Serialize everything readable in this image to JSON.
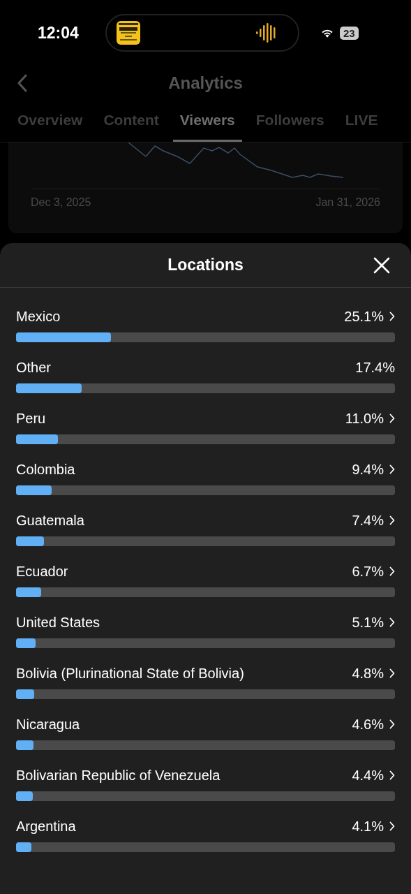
{
  "status_bar": {
    "time": "12:04",
    "battery": "23"
  },
  "header": {
    "title": "Analytics"
  },
  "tabs": [
    {
      "label": "Overview",
      "selected": false
    },
    {
      "label": "Content",
      "selected": false
    },
    {
      "label": "Viewers",
      "selected": true
    },
    {
      "label": "Followers",
      "selected": false
    },
    {
      "label": "LIVE",
      "selected": false
    }
  ],
  "chart": {
    "start_date": "Dec 3, 2025",
    "end_date": "Jan 31, 2026"
  },
  "sheet": {
    "title": "Locations",
    "locations": [
      {
        "name": "Mexico",
        "share": "25.1%",
        "level": 0.251,
        "has_details": true
      },
      {
        "name": "Other",
        "share": "17.4%",
        "level": 0.174,
        "has_details": false
      },
      {
        "name": "Peru",
        "share": "11.0%",
        "level": 0.11,
        "has_details": true
      },
      {
        "name": "Colombia",
        "share": "9.4%",
        "level": 0.094,
        "has_details": true
      },
      {
        "name": "Guatemala",
        "share": "7.4%",
        "level": 0.074,
        "has_details": true
      },
      {
        "name": "Ecuador",
        "share": "6.7%",
        "level": 0.067,
        "has_details": true
      },
      {
        "name": "United States",
        "share": "5.1%",
        "level": 0.051,
        "has_details": true
      },
      {
        "name": "Bolivia (Plurinational State of Bolivia)",
        "share": "4.8%",
        "level": 0.048,
        "has_details": true
      },
      {
        "name": "Nicaragua",
        "share": "4.6%",
        "level": 0.046,
        "has_details": true
      },
      {
        "name": "Bolivarian Republic of Venezuela",
        "share": "4.4%",
        "level": 0.044,
        "has_details": true
      },
      {
        "name": "Argentina",
        "share": "4.1%",
        "level": 0.041,
        "has_details": true
      }
    ]
  }
}
